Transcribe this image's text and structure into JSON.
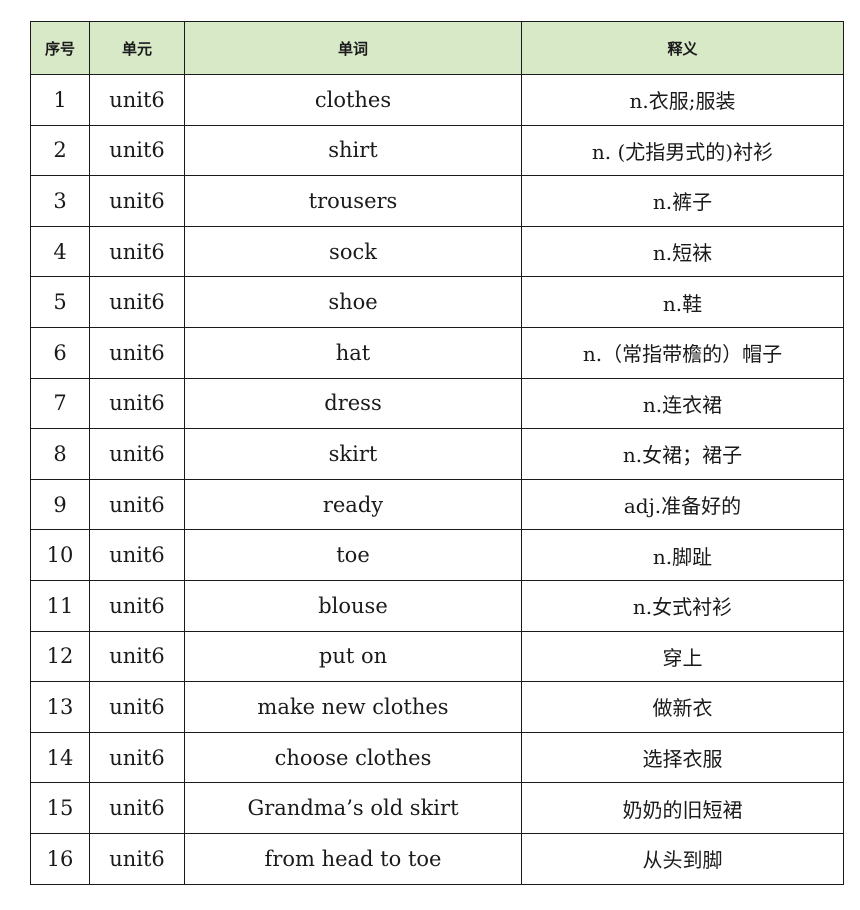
{
  "colors": {
    "header_background": "#d8e9c8",
    "border": "#1a1a1a",
    "text": "#1a1a1a"
  },
  "table": {
    "headers": {
      "index": "序号",
      "unit": "单元",
      "word": "单词",
      "meaning": "释义"
    },
    "rows": [
      {
        "index": "1",
        "unit": "unit6",
        "word": "clothes",
        "meaning": "n.衣服;服装"
      },
      {
        "index": "2",
        "unit": "unit6",
        "word": "shirt",
        "meaning": "n. (尤指男式的)衬衫"
      },
      {
        "index": "3",
        "unit": "unit6",
        "word": "trousers",
        "meaning": "n.裤子"
      },
      {
        "index": "4",
        "unit": "unit6",
        "word": "sock",
        "meaning": "n.短袜"
      },
      {
        "index": "5",
        "unit": "unit6",
        "word": "shoe",
        "meaning": "n.鞋"
      },
      {
        "index": "6",
        "unit": "unit6",
        "word": "hat",
        "meaning": "n.（常指带檐的）帽子"
      },
      {
        "index": "7",
        "unit": "unit6",
        "word": "dress",
        "meaning": "n.连衣裙"
      },
      {
        "index": "8",
        "unit": "unit6",
        "word": "skirt",
        "meaning": "n.女裙；裙子"
      },
      {
        "index": "9",
        "unit": "unit6",
        "word": "ready",
        "meaning": "adj.准备好的"
      },
      {
        "index": "10",
        "unit": "unit6",
        "word": "toe",
        "meaning": "n.脚趾"
      },
      {
        "index": "11",
        "unit": "unit6",
        "word": "blouse",
        "meaning": "n.女式衬衫"
      },
      {
        "index": "12",
        "unit": "unit6",
        "word": "put on",
        "meaning": "穿上"
      },
      {
        "index": "13",
        "unit": "unit6",
        "word": "make new clothes",
        "meaning": "做新衣"
      },
      {
        "index": "14",
        "unit": "unit6",
        "word": "choose clothes",
        "meaning": "选择衣服"
      },
      {
        "index": "15",
        "unit": "unit6",
        "word": "Grandma’s old skirt",
        "meaning": "奶奶的旧短裙"
      },
      {
        "index": "16",
        "unit": "unit6",
        "word": "from head to toe",
        "meaning": "从头到脚"
      }
    ]
  }
}
